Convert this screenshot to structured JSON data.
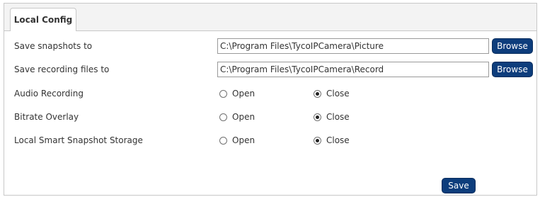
{
  "tabs": [
    {
      "label": "Local Config",
      "active": true
    }
  ],
  "paths": [
    {
      "label": "Save snapshots to",
      "value": "C:\\Program Files\\TycoIPCamera\\Picture",
      "button": "Browse"
    },
    {
      "label": "Save recording files to",
      "value": "C:\\Program Files\\TycoIPCamera\\Record",
      "button": "Browse"
    }
  ],
  "options": [
    {
      "label": "Audio Recording",
      "open_label": "Open",
      "close_label": "Close",
      "selected": "Close"
    },
    {
      "label": "Bitrate Overlay",
      "open_label": "Open",
      "close_label": "Close",
      "selected": "Close"
    },
    {
      "label": "Local Smart Snapshot Storage",
      "open_label": "Open",
      "close_label": "Close",
      "selected": "Close"
    }
  ],
  "actions": {
    "save_label": "Save"
  },
  "colors": {
    "button_bg": "#0d3d7c",
    "tab_bar_bg": "#f3f3f3",
    "border": "#c8c8c8"
  }
}
